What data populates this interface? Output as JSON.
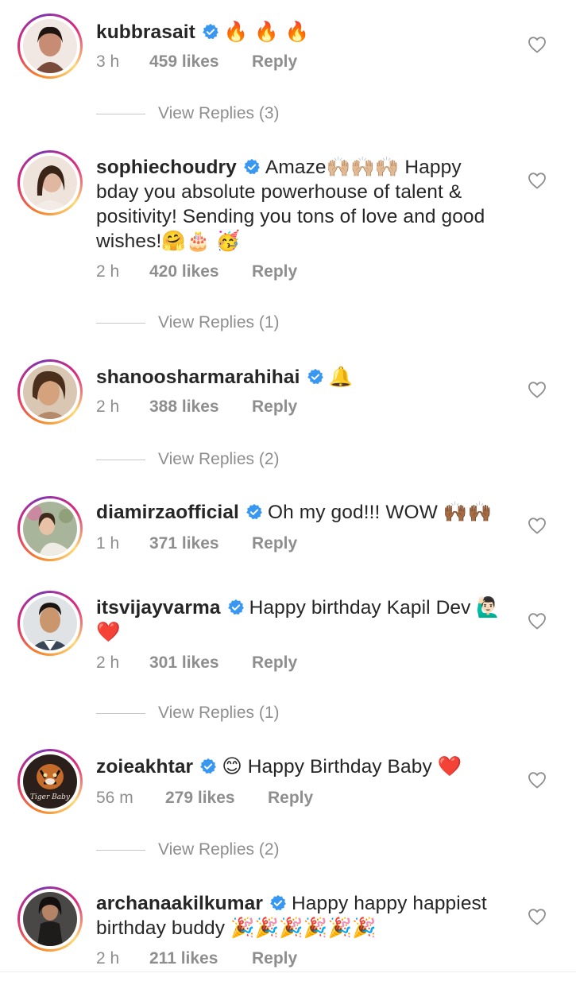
{
  "comments": [
    {
      "username": "kubbrasait",
      "text": "",
      "emoji_after": "🔥 🔥 🔥",
      "time": "3 h",
      "likes": "459 likes",
      "reply": "Reply",
      "view_replies": "View Replies (3)",
      "avatar_color": "#7a4a3a"
    },
    {
      "username": "sophiechoudry",
      "text": "Amaze🙌🏼🙌🏼🙌🏼 Happy bday you absolute powerhouse of talent & positivity! Sending you tons of love and good wishes!🤗🎂 🥳",
      "emoji_after": "",
      "time": "2 h",
      "likes": "420 likes",
      "reply": "Reply",
      "view_replies": "View Replies (1)",
      "avatar_color": "#c89b86"
    },
    {
      "username": "shanoosharmarahihai",
      "text": "",
      "emoji_after": "🔔",
      "time": "2 h",
      "likes": "388 likes",
      "reply": "Reply",
      "view_replies": "View Replies (2)",
      "avatar_color": "#b58a6a"
    },
    {
      "username": "diamirzaofficial",
      "text": "Oh my god!!! WOW 🙌🏾🙌🏾",
      "emoji_after": "",
      "time": "1 h",
      "likes": "371 likes",
      "reply": "Reply",
      "view_replies": "",
      "avatar_color": "#a9b59a"
    },
    {
      "username": "itsvijayvarma",
      "text": "Happy birthday Kapil Dev 🙋🏻‍♂️❤️",
      "emoji_after": "",
      "time": "2 h",
      "likes": "301 likes",
      "reply": "Reply",
      "view_replies": "View Replies (1)",
      "avatar_color": "#5a6a78"
    },
    {
      "username": "zoieakhtar",
      "text": "😊 Happy Birthday Baby ❤️",
      "emoji_after": "",
      "time": "56 m",
      "likes": "279 likes",
      "reply": "Reply",
      "view_replies": "View Replies (2)",
      "avatar_color": "#3b2a22"
    },
    {
      "username": "archanaakilkumar",
      "text": "Happy happy happiest birthday buddy 🎉🎉🎉🎉🎉🎉",
      "emoji_after": "",
      "time": "2 h",
      "likes": "211 likes",
      "reply": "Reply",
      "view_replies": "",
      "avatar_color": "#2a2a2a"
    }
  ],
  "colors": {
    "verified": "#3897f0",
    "meta": "#8e8e8e",
    "text": "#262626"
  }
}
